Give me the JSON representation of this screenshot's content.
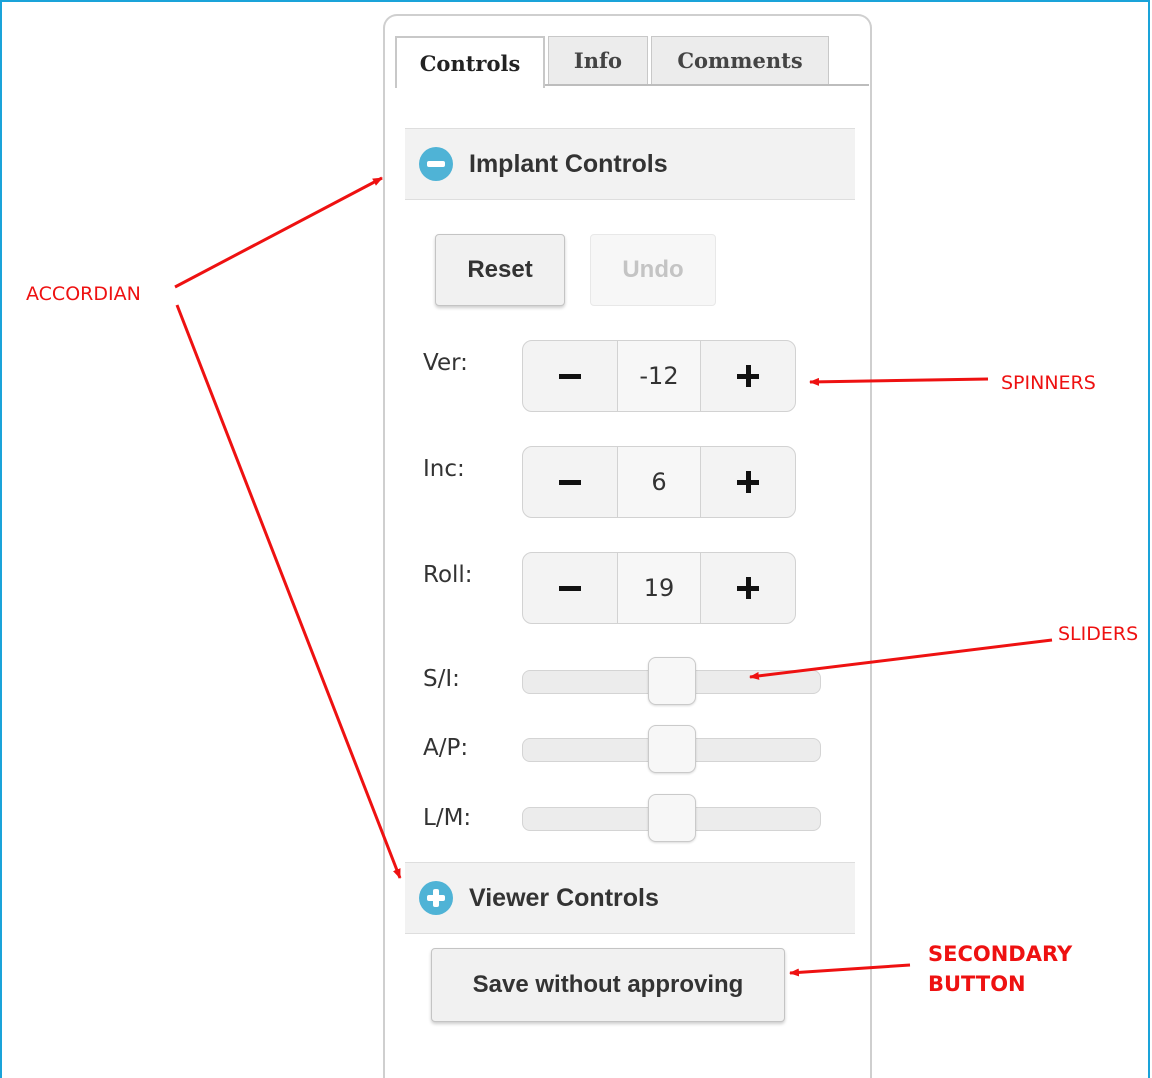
{
  "tabs": [
    {
      "label": "Controls",
      "active": true
    },
    {
      "label": "Info",
      "active": false
    },
    {
      "label": "Comments",
      "active": false
    }
  ],
  "implant_section": {
    "title": "Implant Controls",
    "expanded": true,
    "reset_label": "Reset",
    "undo_label": "Undo",
    "spinners": [
      {
        "label": "Ver:",
        "value": "-12"
      },
      {
        "label": "Inc:",
        "value": "6"
      },
      {
        "label": "Roll:",
        "value": "19"
      }
    ],
    "sliders": [
      {
        "label": "S/I:",
        "value_fraction": 0.5
      },
      {
        "label": "A/P:",
        "value_fraction": 0.5
      },
      {
        "label": "L/M:",
        "value_fraction": 0.5
      }
    ]
  },
  "viewer_section": {
    "title": "Viewer Controls",
    "expanded": false
  },
  "secondary_button_label": "Save without approving",
  "annotations": {
    "accordian": "ACCORDIAN",
    "spinners": "SPINNERS",
    "sliders": "SLIDERS",
    "secondary_button_line1": "SECONDARY",
    "secondary_button_line2": "BUTTON"
  },
  "colors": {
    "frame_border": "#1aa3d9",
    "accordion_icon": "#4fb3d6",
    "annotation": "#e11111"
  }
}
